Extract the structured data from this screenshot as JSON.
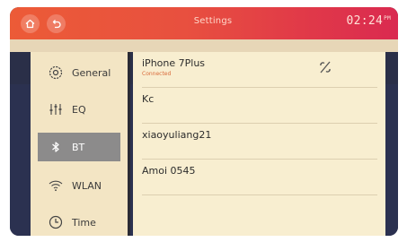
{
  "header": {
    "title": "Settings",
    "clock": "02:24",
    "clock_suffix": "PM"
  },
  "sidebar": {
    "items": [
      {
        "label": "General",
        "icon": "gear-icon"
      },
      {
        "label": "EQ",
        "icon": "equalizer-icon"
      },
      {
        "label": "BT",
        "icon": "bluetooth-icon",
        "active": true
      },
      {
        "label": "WLAN",
        "icon": "wifi-icon"
      },
      {
        "label": "Time",
        "icon": "clock-icon"
      }
    ]
  },
  "devices": [
    {
      "name": "iPhone 7Plus",
      "status": "Connected",
      "action_icon": "disconnect-icon"
    },
    {
      "name": "Kc"
    },
    {
      "name": "xiaoyuliang21"
    },
    {
      "name": "Amoi 0545"
    }
  ],
  "colors": {
    "topbar_start": "#ec5b37",
    "topbar_end": "#da2a50",
    "sidebar_bg": "#f3e5c4",
    "content_bg": "#f8eed0",
    "active_item_bg": "#8c8b8b",
    "status_text": "#d96a3a"
  }
}
